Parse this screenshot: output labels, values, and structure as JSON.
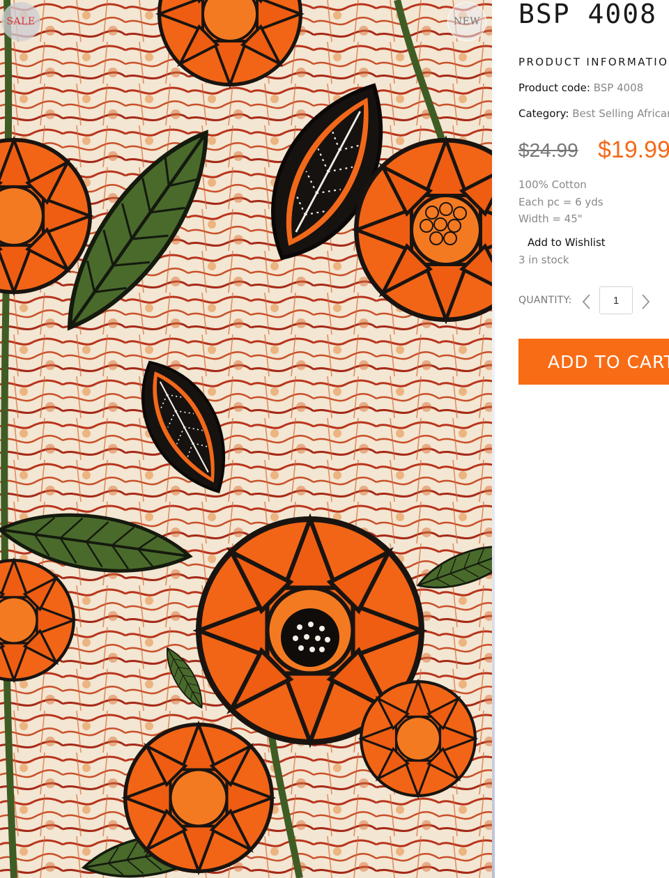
{
  "product": {
    "title": "BSP 4008",
    "image_alt": "Orange and green floral African wax print fabric",
    "badges": {
      "sale": "SALE",
      "new": "NEW"
    }
  },
  "info": {
    "section_heading": "PRODUCT INFORMATION",
    "code_label": "Product code:",
    "code_value": "BSP 4008",
    "category_label": "Category:",
    "category_value": "Best Selling African Prints"
  },
  "price": {
    "old": "$24.99",
    "new": "$19.99",
    "accent_color": "#f26a1b"
  },
  "details": {
    "line1": "100% Cotton",
    "line2": "Each pc = 6 yds",
    "line3": "Width = 45\""
  },
  "wishlist_label": "Add to Wishlist",
  "stock_text": "3 in stock",
  "quantity": {
    "label": "QUANTITY:",
    "value": "1"
  },
  "cart": {
    "button_label": "ADD TO CART",
    "button_color": "#f86c15"
  },
  "icons": {
    "qty_prev": "chevron-left-icon",
    "qty_next": "chevron-right-icon"
  }
}
